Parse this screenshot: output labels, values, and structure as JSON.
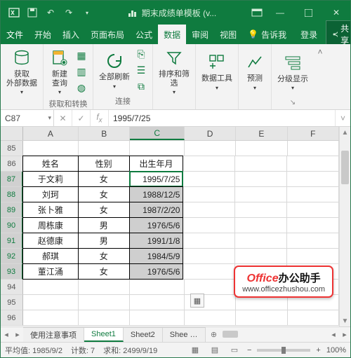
{
  "title": "期末成绩单模板 (v...",
  "winctl": {
    "min": "—",
    "max": "▢",
    "close": "✕"
  },
  "qat": {
    "save": "💾",
    "undo": "↶",
    "redo": "↷",
    "customize": "▾"
  },
  "tabs": {
    "file": "文件",
    "home": "开始",
    "insert": "插入",
    "layout": "页面布局",
    "formulas": "公式",
    "data": "数据",
    "review": "审阅",
    "view": "视图",
    "tellme": "告诉我",
    "signin": "登录",
    "share": "共享"
  },
  "ribbon": {
    "get_external": "获取\n外部数据",
    "new_query": "新建\n查询",
    "refresh_all": "全部刷新",
    "sort_filter": "排序和筛选",
    "data_tools": "数据工具",
    "forecast": "预测",
    "outline": "分级显示",
    "group_convert": "获取和转换",
    "group_conn": "连接"
  },
  "namebox": "C87",
  "formula": "1995/7/25",
  "cols": [
    "A",
    "B",
    "C",
    "D",
    "E",
    "F"
  ],
  "rownums": [
    "85",
    "86",
    "87",
    "88",
    "89",
    "90",
    "91",
    "92",
    "93",
    "94",
    "95",
    "96"
  ],
  "headers": {
    "name": "姓名",
    "gender": "性别",
    "dob": "出生年月"
  },
  "data_rows": [
    {
      "name": "于文莉",
      "gender": "女",
      "dob": "1995/7/25"
    },
    {
      "name": "刘珂",
      "gender": "女",
      "dob": "1988/12/5"
    },
    {
      "name": "张卜雅",
      "gender": "女",
      "dob": "1987/2/20"
    },
    {
      "name": "周栋康",
      "gender": "男",
      "dob": "1976/5/6"
    },
    {
      "name": "赵德康",
      "gender": "男",
      "dob": "1991/1/8"
    },
    {
      "name": "郝琪",
      "gender": "女",
      "dob": "1984/5/9"
    },
    {
      "name": "董江涌",
      "gender": "女",
      "dob": "1976/5/6"
    }
  ],
  "sheets": {
    "s0": "使用注意事项",
    "s1": "Sheet1",
    "s2": "Sheet2",
    "s3": "Shee …"
  },
  "status": {
    "avg": "平均值: 1985/9/2",
    "count": "计数: 7",
    "sum": "求和: 2499/9/19",
    "zoom": "100%"
  },
  "watermark": {
    "brand": "Office",
    "cn": "办公助手",
    "url": "www.officezhushou.com"
  }
}
